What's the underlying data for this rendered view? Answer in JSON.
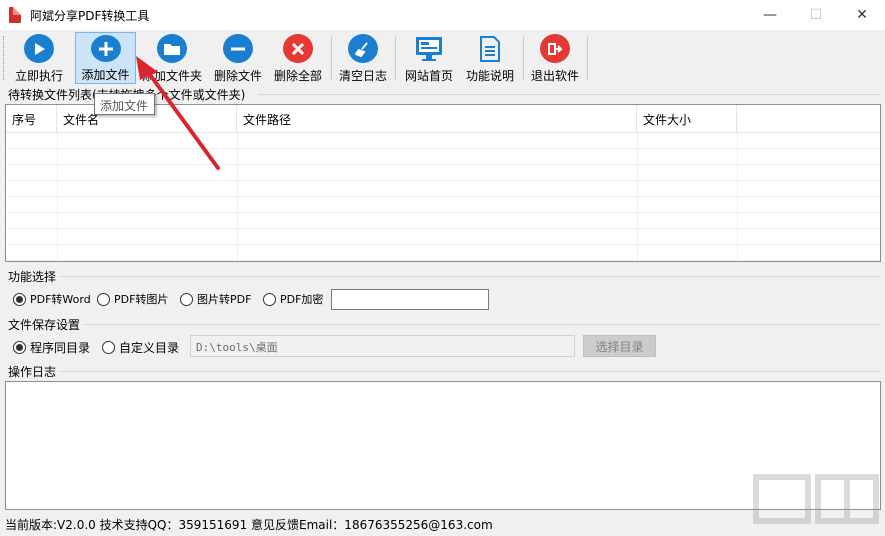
{
  "window": {
    "title": "阿斌分享PDF转换工具",
    "minimize_glyph": "—",
    "maximize_glyph": "☐",
    "close_glyph": "✕"
  },
  "toolbar": {
    "items": [
      {
        "label": "立即执行",
        "icon": "play-icon",
        "color": "#1b7fd1",
        "glyph": "▶"
      },
      {
        "label": "添加文件",
        "icon": "plus-icon",
        "color": "#1b7fd1",
        "glyph": "+"
      },
      {
        "label": "添加文件夹",
        "icon": "folder-icon",
        "color": "#1b7fd1",
        "glyph": ""
      },
      {
        "label": "删除文件",
        "icon": "minus-icon",
        "color": "#1b7fd1",
        "glyph": "−"
      },
      {
        "label": "删除全部",
        "icon": "delete-all-icon",
        "color": "#e53935",
        "glyph": "✕"
      },
      {
        "label": "清空日志",
        "icon": "broom-icon",
        "color": "#1b7fd1",
        "glyph": "✎"
      },
      {
        "label": "网站首页",
        "icon": "monitor-icon",
        "color": "#1b7fd1",
        "glyph": ""
      },
      {
        "label": "功能说明",
        "icon": "document-icon",
        "color": "#1b7fd1",
        "glyph": ""
      },
      {
        "label": "退出软件",
        "icon": "exit-icon",
        "color": "#e53935",
        "glyph": "➜"
      }
    ],
    "tooltip": "添加文件"
  },
  "file_list": {
    "group_label": "待转换文件列表(支持拖拽多个文件或文件夹)",
    "columns": [
      "序号",
      "文件名",
      "文件路径",
      "文件大小"
    ],
    "rows": []
  },
  "function_select": {
    "group_label": "功能选择",
    "options": [
      "PDF转Word",
      "PDF转图片",
      "图片转PDF",
      "PDF加密"
    ],
    "selected": "PDF转Word",
    "password_value": ""
  },
  "save_settings": {
    "group_label": "文件保存设置",
    "options": [
      "程序同目录",
      "自定义目录"
    ],
    "selected": "程序同目录",
    "path_value": "D:\\tools\\桌面",
    "choose_button": "选择目录"
  },
  "log": {
    "group_label": "操作日志"
  },
  "status": {
    "text": "当前版本:V2.0.0   技术支持QQ：359151691   意见反馈Email：18676355256@163.com"
  },
  "colors": {
    "accent": "#1b7fd1",
    "danger": "#e53935",
    "arrow": "#d9262e"
  }
}
